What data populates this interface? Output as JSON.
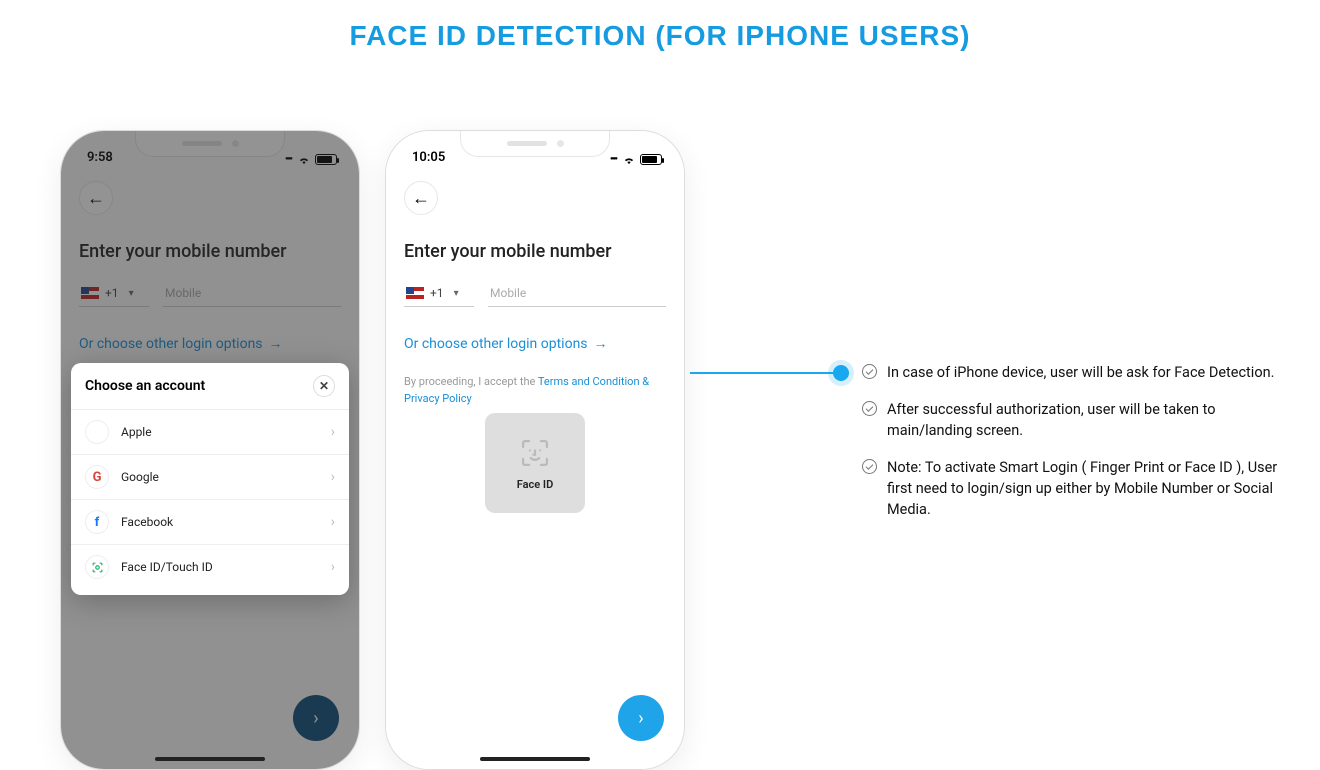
{
  "title": "FACE ID DETECTION (FOR IPHONE USERS)",
  "phone_left": {
    "time": "9:58",
    "heading": "Enter your mobile number",
    "cc": "+1",
    "mobile_placeholder": "Mobile",
    "other_login": "Or choose other login options",
    "sheet_title": "Choose an account",
    "options": {
      "apple": "Apple",
      "google": "Google",
      "facebook": "Facebook",
      "faceid": "Face ID/Touch ID"
    }
  },
  "phone_right": {
    "time": "10:05",
    "heading": "Enter your mobile number",
    "cc": "+1",
    "mobile_placeholder": "Mobile",
    "other_login": "Or choose other login options",
    "terms_prefix": "By proceeding, I accept the ",
    "terms_link": "Terms and Condition & Privacy Policy",
    "faceid_label": "Face ID"
  },
  "callout": {
    "b1": "In case of iPhone device, user will be ask for Face Detection.",
    "b2": "After successful authorization, user will be taken to main/landing screen.",
    "b3": "Note: To activate Smart Login ( Finger Print or Face ID ), User first need to login/sign up either by Mobile Number or Social Media."
  }
}
